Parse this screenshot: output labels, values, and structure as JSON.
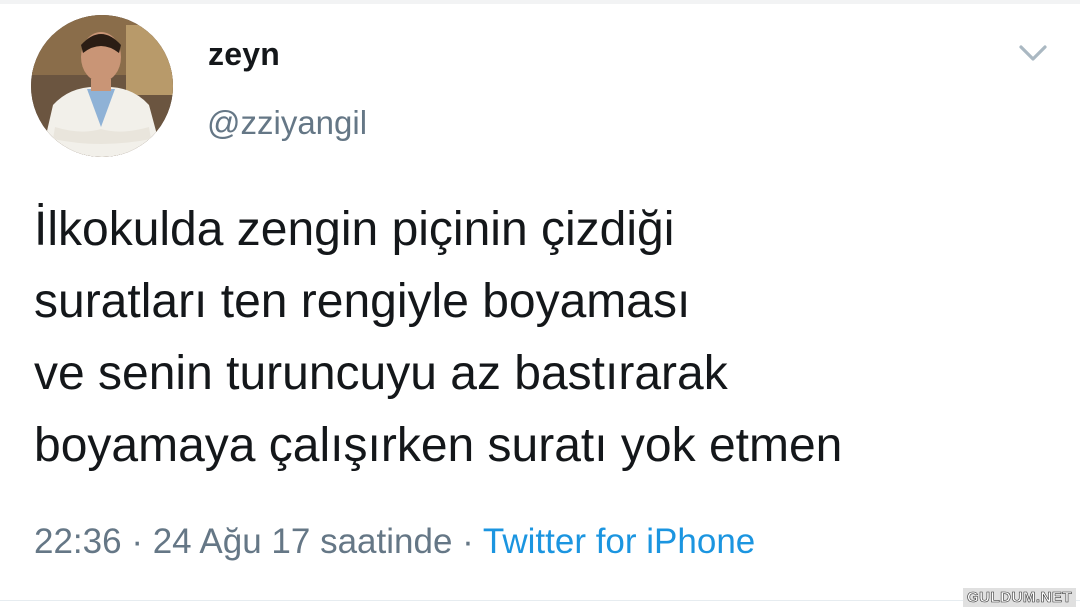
{
  "author": {
    "display_name": "zeyn",
    "handle": "@zziyangil",
    "avatar_icon": "avatar-photo-icon"
  },
  "tweet": {
    "lines": [
      "İlkokulda zengin piçinin çizdiği",
      "suratları ten rengiyle boyaması",
      "ve senin turuncuyu az bastırarak",
      "boyamaya çalışırken suratı yok etmen"
    ]
  },
  "meta": {
    "time": "22:36",
    "separator": " · ",
    "date": "24 Ağu 17 saatinde",
    "source": "Twitter for iPhone"
  },
  "menu": {
    "caret_icon": "chevron-down-icon"
  },
  "watermark": "GULDUM.NET",
  "colors": {
    "text": "#14171a",
    "secondary": "#657786",
    "link": "#1b95e0"
  }
}
